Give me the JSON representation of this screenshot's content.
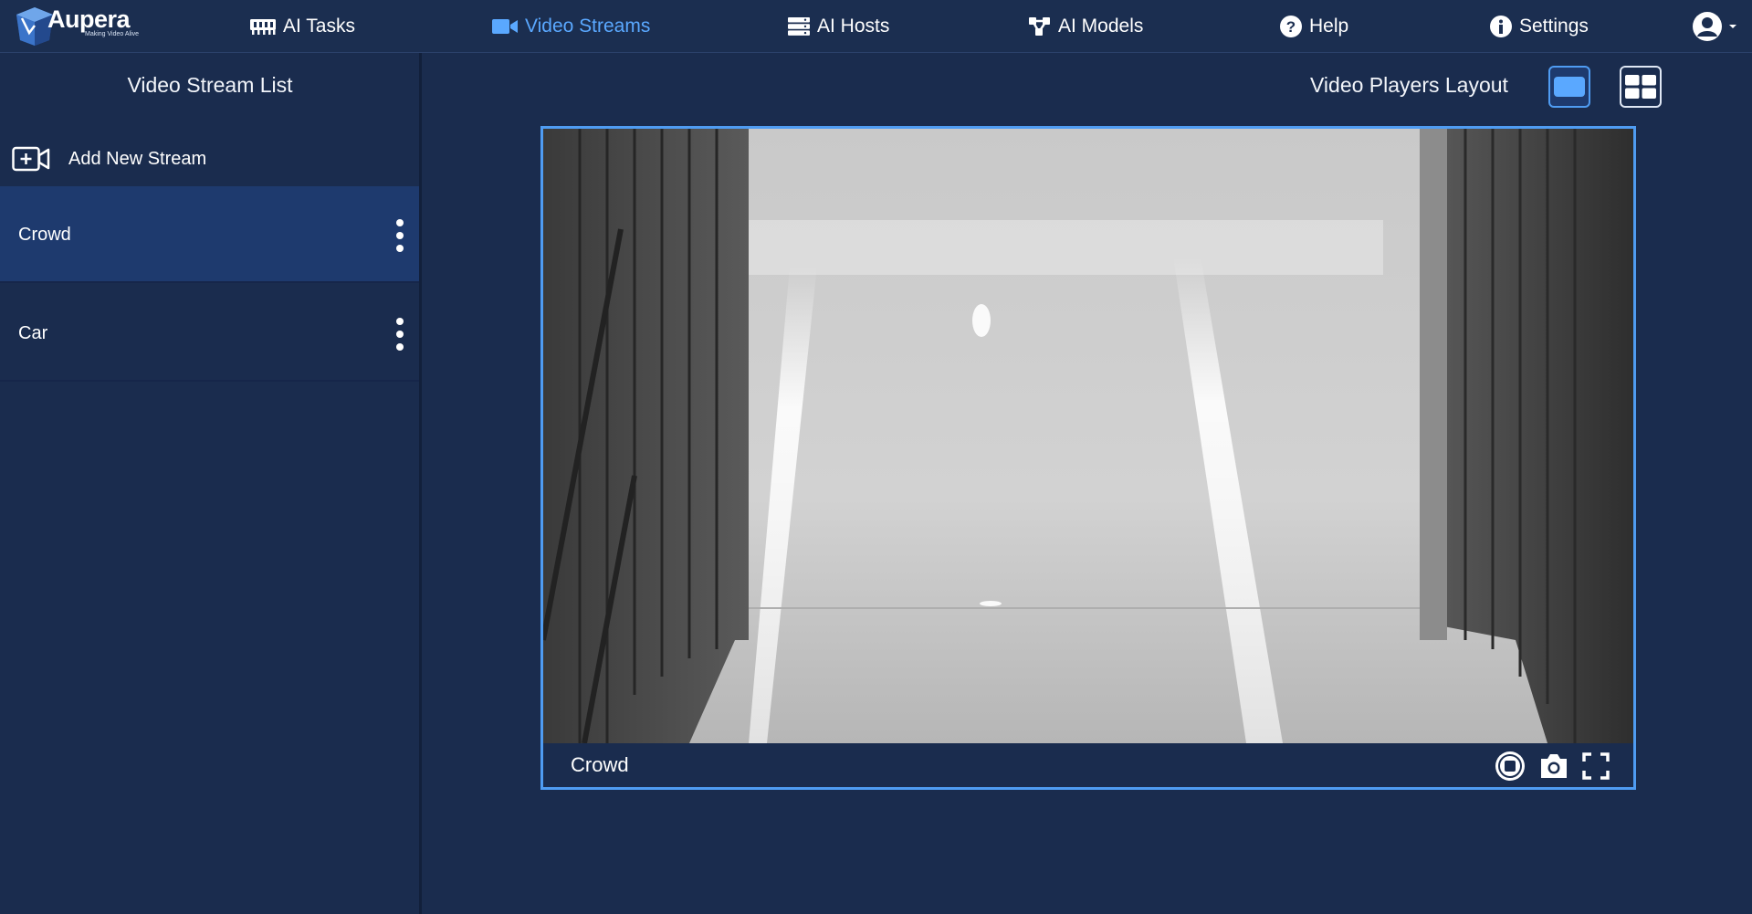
{
  "brand": {
    "name": "Aupera",
    "tagline": "Making Video Alive"
  },
  "nav": {
    "items": [
      {
        "label": "AI Tasks",
        "icon": "ai-tasks-icon"
      },
      {
        "label": "Video Streams",
        "icon": "video-camera-icon",
        "active": true
      },
      {
        "label": "AI Hosts",
        "icon": "server-icon"
      },
      {
        "label": "AI Models",
        "icon": "model-network-icon"
      },
      {
        "label": "Help",
        "icon": "help-circle-icon"
      },
      {
        "label": "Settings",
        "icon": "info-circle-icon"
      }
    ],
    "user_icon": "user-avatar-icon"
  },
  "sidebar": {
    "title": "Video Stream List",
    "add_label": "Add New Stream",
    "streams": [
      {
        "name": "Crowd",
        "selected": true
      },
      {
        "name": "Car",
        "selected": false
      }
    ]
  },
  "main": {
    "layout_label": "Video Players Layout",
    "layout_options": [
      "single-view-icon",
      "grid-view-icon"
    ],
    "selected_layout": "single-view-icon",
    "player": {
      "stream_name": "Crowd",
      "controls": [
        "stop-icon",
        "camera-snapshot-icon",
        "fullscreen-icon"
      ]
    }
  },
  "colors": {
    "background": "#1a2c4e",
    "nav_background": "#1b2e50",
    "accent": "#4f9cf2",
    "active_nav": "#5aa8ff",
    "selected_row": "#1e3a6e"
  }
}
